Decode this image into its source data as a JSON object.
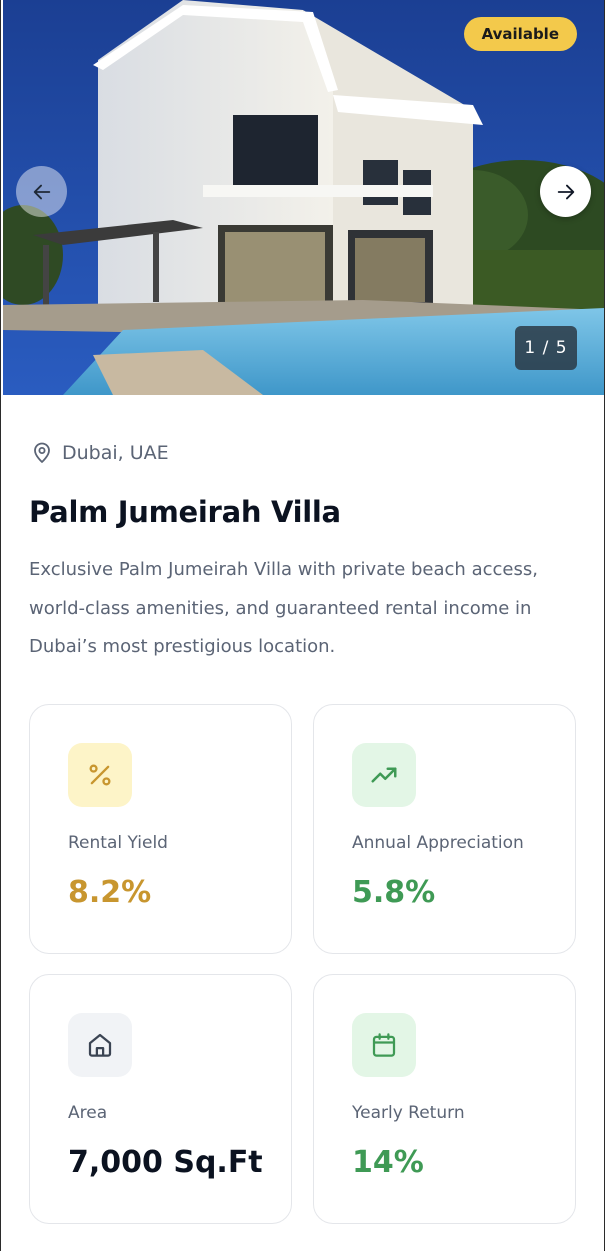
{
  "hero": {
    "status_badge": "Available",
    "image_counter": "1 / 5",
    "prev_icon": "arrow-left-icon",
    "next_icon": "arrow-right-icon"
  },
  "property": {
    "location": "Dubai, UAE",
    "location_icon": "map-pin-icon",
    "title": "Palm Jumeirah Villa",
    "description": "Exclusive Palm Jumeirah Villa with private beach access, world-class amenities, and guaranteed rental income in Dubai’s most prestigious location."
  },
  "stats": [
    {
      "label": "Rental Yield",
      "value": "8.2%",
      "icon": "percent-icon",
      "value_color": "#c8962f",
      "icon_bg": "#fdf4c8",
      "icon_color": "#c8962f"
    },
    {
      "label": "Annual Appreciation",
      "value": "5.8%",
      "icon": "trending-up-icon",
      "value_color": "#3f9a55",
      "icon_bg": "#e3f6e6",
      "icon_color": "#3f9a55"
    },
    {
      "label": "Area",
      "value": "7,000 Sq.Ft",
      "icon": "home-icon",
      "value_color": "#0b1220",
      "icon_bg": "#f1f3f6",
      "icon_color": "#3b4453"
    },
    {
      "label": "Yearly Return",
      "value": "14%",
      "icon": "calendar-icon",
      "value_color": "#3f9a55",
      "icon_bg": "#e3f6e6",
      "icon_color": "#3f9a55"
    }
  ],
  "colors": {
    "accent_yellow": "#f3c94b",
    "text_muted": "#5b6475",
    "text_dark": "#0b1220"
  }
}
